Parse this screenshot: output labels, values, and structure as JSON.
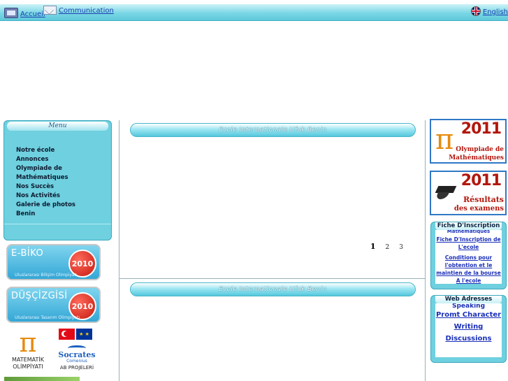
{
  "nav": {
    "home_label": "Accueil",
    "communication_label": "Communication",
    "language_label": "English"
  },
  "menu": {
    "title": "Menu",
    "items": [
      "Notre école",
      "Annonces",
      "Olympiade de Mathématiques",
      "Nos Succès",
      "Nos Activités",
      "Galerie de photos",
      "Benin"
    ]
  },
  "banners": [
    {
      "title": "E-BİKO",
      "subtitle": "Uluslararası Bilişim Olimpiyatı",
      "year": "2010"
    },
    {
      "title": "DÜŞÇİZGİSİ",
      "subtitle": "Uluslararası Tasarım Olimpiyatı",
      "year": "2010"
    }
  ],
  "logos": {
    "math_line1": "MATEMATİK",
    "math_line2": "OLİMPİYATI",
    "socrates_name": "Socrates",
    "socrates_program": "Comenius",
    "socrates_caption": "AB PROJELERİ"
  },
  "center": {
    "panel1_title": "Ecole Internationale  Ufuk Benin",
    "panel2_title": "Ecole Internationale  Ufuk Benin",
    "pager": {
      "current": "1",
      "pages": [
        "2",
        "3"
      ]
    }
  },
  "promos": {
    "olympiad_year": "2011",
    "olympiad_caption_1": "Olympiade de",
    "olympiad_caption_2": "Mathématiques",
    "results_year": "2011",
    "results_caption_1": "Résultats",
    "results_caption_2": "des examens"
  },
  "inscription": {
    "title": "Fiche D'Inscription",
    "cut_text": "Mathématiques",
    "links": [
      "Fiche D'Inscription de L'ecole",
      "Conditions pour l'obtention et le maintien de la bourse A l'ecole"
    ]
  },
  "web": {
    "title": "Web Adresses",
    "cut_text": "Speaking",
    "links": [
      "Promt Character",
      "Writing",
      "Discussions"
    ]
  },
  "colors": {
    "accent": "#6fd0df",
    "link": "#1a2fb8",
    "badge_red": "#c41a10"
  }
}
